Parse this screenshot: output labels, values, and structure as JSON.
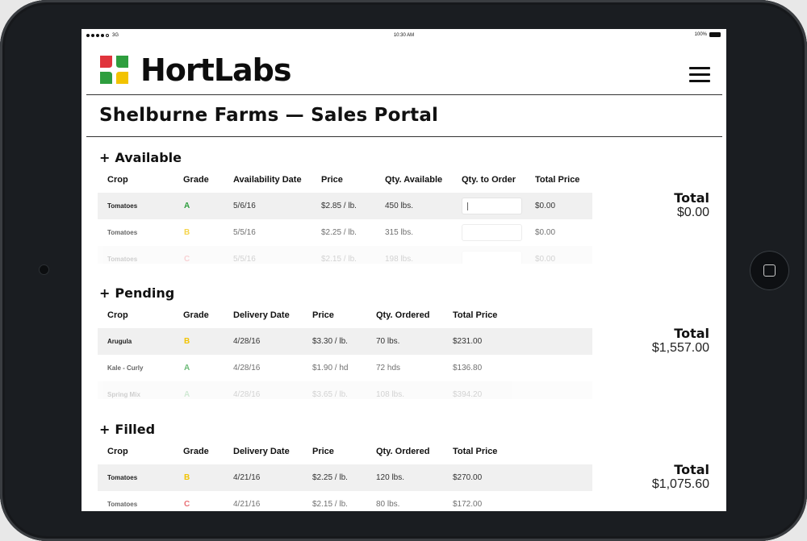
{
  "status_bar": {
    "signal": "3G",
    "time": "10:30 AM",
    "battery": "100%"
  },
  "app": {
    "brand": "HortLabs",
    "page_title": "Shelburne Farms — Sales Portal"
  },
  "colors": {
    "grade_a": "#2e9e3e",
    "grade_b": "#f2c300",
    "grade_c": "#e0343c",
    "logo_red": "#e0343c",
    "logo_green": "#2e9e3e",
    "logo_blue": "#1f6fd1",
    "logo_yellow": "#f2c300"
  },
  "available": {
    "title": "Available",
    "headers": {
      "crop": "Crop",
      "grade": "Grade",
      "date": "Availability Date",
      "price": "Price",
      "qty": "Qty. Available",
      "order": "Qty. to Order",
      "total": "Total Price"
    },
    "rows": [
      {
        "crop": "Tomatoes",
        "grade": "A",
        "date": "5/6/16",
        "price": "$2.85 / lb.",
        "qty": "450 lbs.",
        "total": "$0.00"
      },
      {
        "crop": "Tomatoes",
        "grade": "B",
        "date": "5/5/16",
        "price": "$2.25 / lb.",
        "qty": "315 lbs.",
        "total": "$0.00"
      },
      {
        "crop": "Tomatoes",
        "grade": "C",
        "date": "5/5/16",
        "price": "$2.15 / lb.",
        "qty": "198 lbs.",
        "total": "$0.00"
      }
    ],
    "total_label": "Total",
    "total_value": "$0.00"
  },
  "pending": {
    "title": "Pending",
    "headers": {
      "crop": "Crop",
      "grade": "Grade",
      "date": "Delivery Date",
      "price": "Price",
      "qty": "Qty. Ordered",
      "total": "Total Price"
    },
    "rows": [
      {
        "crop": "Arugula",
        "grade": "B",
        "date": "4/28/16",
        "price": "$3.30 / lb.",
        "qty": "70 lbs.",
        "total": "$231.00"
      },
      {
        "crop": "Kale - Curly",
        "grade": "A",
        "date": "4/28/16",
        "price": "$1.90 / hd",
        "qty": "72 hds",
        "total": "$136.80"
      },
      {
        "crop": "Spring Mix",
        "grade": "A",
        "date": "4/28/16",
        "price": "$3.65 / lb.",
        "qty": "108 lbs.",
        "total": "$394.20"
      }
    ],
    "total_label": "Total",
    "total_value": "$1,557.00"
  },
  "filled": {
    "title": "Filled",
    "headers": {
      "crop": "Crop",
      "grade": "Grade",
      "date": "Delivery Date",
      "price": "Price",
      "qty": "Qty. Ordered",
      "total": "Total Price"
    },
    "rows": [
      {
        "crop": "Tomatoes",
        "grade": "B",
        "date": "4/21/16",
        "price": "$2.25 / lb.",
        "qty": "120 lbs.",
        "total": "$270.00"
      },
      {
        "crop": "Tomatoes",
        "grade": "C",
        "date": "4/21/16",
        "price": "$2.15 / lb.",
        "qty": "80 lbs.",
        "total": "$172.00"
      }
    ],
    "total_label": "Total",
    "total_value": "$1,075.60"
  }
}
